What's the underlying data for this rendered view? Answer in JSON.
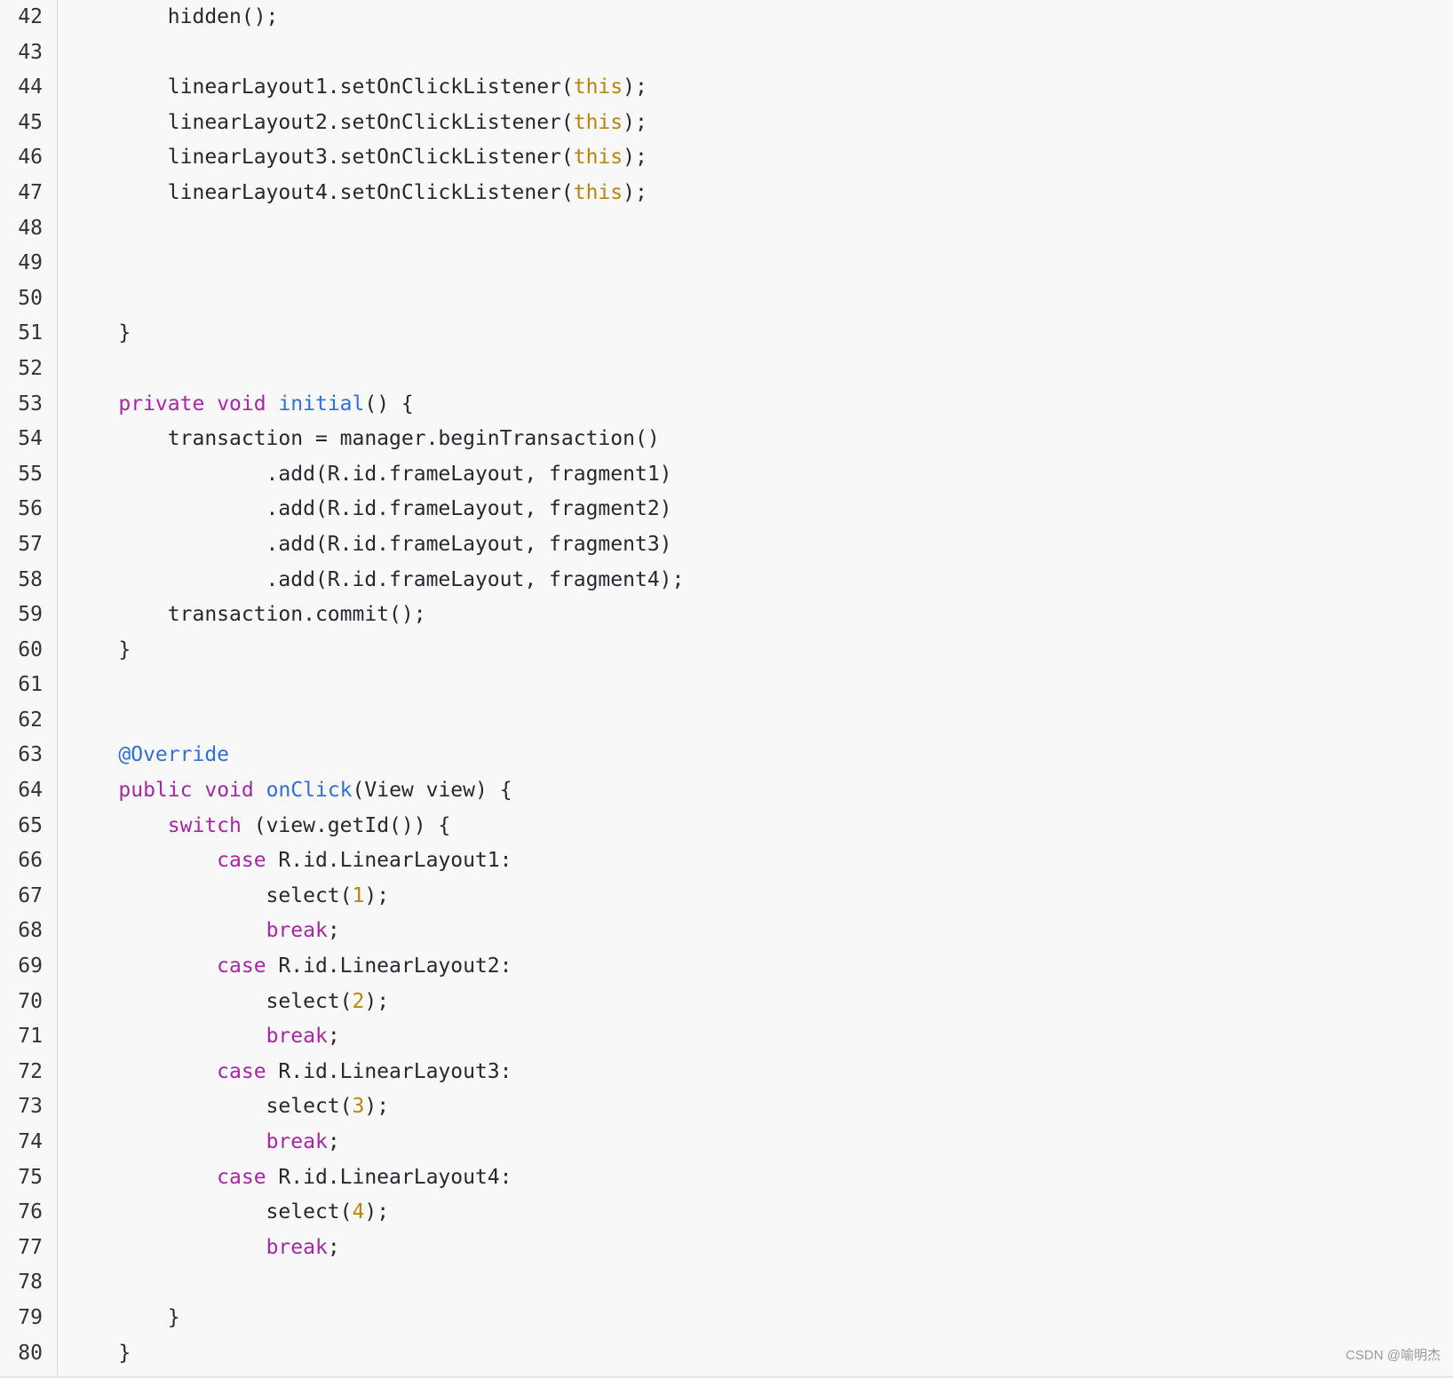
{
  "colors": {
    "background": "#f8f8f8",
    "keyword": "#a626a4",
    "literal": "#b8860b",
    "function": "#2f6fd6",
    "annotation": "#2f6fd6",
    "text": "#24292e"
  },
  "code": {
    "lines": [
      {
        "num": "42",
        "tokens": [
          {
            "t": "txt",
            "v": "        hidden();"
          }
        ]
      },
      {
        "num": "43",
        "tokens": []
      },
      {
        "num": "44",
        "tokens": [
          {
            "t": "txt",
            "v": "        linearLayout1.setOnClickListener("
          },
          {
            "t": "lit",
            "v": "this"
          },
          {
            "t": "txt",
            "v": ");"
          }
        ]
      },
      {
        "num": "45",
        "tokens": [
          {
            "t": "txt",
            "v": "        linearLayout2.setOnClickListener("
          },
          {
            "t": "lit",
            "v": "this"
          },
          {
            "t": "txt",
            "v": ");"
          }
        ]
      },
      {
        "num": "46",
        "tokens": [
          {
            "t": "txt",
            "v": "        linearLayout3.setOnClickListener("
          },
          {
            "t": "lit",
            "v": "this"
          },
          {
            "t": "txt",
            "v": ");"
          }
        ]
      },
      {
        "num": "47",
        "tokens": [
          {
            "t": "txt",
            "v": "        linearLayout4.setOnClickListener("
          },
          {
            "t": "lit",
            "v": "this"
          },
          {
            "t": "txt",
            "v": ");"
          }
        ]
      },
      {
        "num": "48",
        "tokens": []
      },
      {
        "num": "49",
        "tokens": []
      },
      {
        "num": "50",
        "tokens": []
      },
      {
        "num": "51",
        "tokens": [
          {
            "t": "txt",
            "v": "    }"
          }
        ]
      },
      {
        "num": "52",
        "tokens": []
      },
      {
        "num": "53",
        "tokens": [
          {
            "t": "txt",
            "v": "    "
          },
          {
            "t": "kw",
            "v": "private"
          },
          {
            "t": "txt",
            "v": " "
          },
          {
            "t": "kw",
            "v": "void"
          },
          {
            "t": "txt",
            "v": " "
          },
          {
            "t": "fn",
            "v": "initial"
          },
          {
            "t": "txt",
            "v": "() {"
          }
        ]
      },
      {
        "num": "54",
        "tokens": [
          {
            "t": "txt",
            "v": "        transaction = manager.beginTransaction()"
          }
        ]
      },
      {
        "num": "55",
        "tokens": [
          {
            "t": "txt",
            "v": "                .add(R.id.frameLayout, fragment1)"
          }
        ]
      },
      {
        "num": "56",
        "tokens": [
          {
            "t": "txt",
            "v": "                .add(R.id.frameLayout, fragment2)"
          }
        ]
      },
      {
        "num": "57",
        "tokens": [
          {
            "t": "txt",
            "v": "                .add(R.id.frameLayout, fragment3)"
          }
        ]
      },
      {
        "num": "58",
        "tokens": [
          {
            "t": "txt",
            "v": "                .add(R.id.frameLayout, fragment4);"
          }
        ]
      },
      {
        "num": "59",
        "tokens": [
          {
            "t": "txt",
            "v": "        transaction.commit();"
          }
        ]
      },
      {
        "num": "60",
        "tokens": [
          {
            "t": "txt",
            "v": "    }"
          }
        ]
      },
      {
        "num": "61",
        "tokens": []
      },
      {
        "num": "62",
        "tokens": []
      },
      {
        "num": "63",
        "tokens": [
          {
            "t": "txt",
            "v": "    "
          },
          {
            "t": "ann",
            "v": "@Override"
          }
        ]
      },
      {
        "num": "64",
        "tokens": [
          {
            "t": "txt",
            "v": "    "
          },
          {
            "t": "kw",
            "v": "public"
          },
          {
            "t": "txt",
            "v": " "
          },
          {
            "t": "kw",
            "v": "void"
          },
          {
            "t": "txt",
            "v": " "
          },
          {
            "t": "fn",
            "v": "onClick"
          },
          {
            "t": "txt",
            "v": "(View view) {"
          }
        ]
      },
      {
        "num": "65",
        "tokens": [
          {
            "t": "txt",
            "v": "        "
          },
          {
            "t": "kw",
            "v": "switch"
          },
          {
            "t": "txt",
            "v": " (view.getId()) {"
          }
        ]
      },
      {
        "num": "66",
        "tokens": [
          {
            "t": "txt",
            "v": "            "
          },
          {
            "t": "kw",
            "v": "case"
          },
          {
            "t": "txt",
            "v": " R.id.LinearLayout1:"
          }
        ]
      },
      {
        "num": "67",
        "tokens": [
          {
            "t": "txt",
            "v": "                select("
          },
          {
            "t": "lit",
            "v": "1"
          },
          {
            "t": "txt",
            "v": ");"
          }
        ]
      },
      {
        "num": "68",
        "tokens": [
          {
            "t": "txt",
            "v": "                "
          },
          {
            "t": "kw",
            "v": "break"
          },
          {
            "t": "txt",
            "v": ";"
          }
        ]
      },
      {
        "num": "69",
        "tokens": [
          {
            "t": "txt",
            "v": "            "
          },
          {
            "t": "kw",
            "v": "case"
          },
          {
            "t": "txt",
            "v": " R.id.LinearLayout2:"
          }
        ]
      },
      {
        "num": "70",
        "tokens": [
          {
            "t": "txt",
            "v": "                select("
          },
          {
            "t": "lit",
            "v": "2"
          },
          {
            "t": "txt",
            "v": ");"
          }
        ]
      },
      {
        "num": "71",
        "tokens": [
          {
            "t": "txt",
            "v": "                "
          },
          {
            "t": "kw",
            "v": "break"
          },
          {
            "t": "txt",
            "v": ";"
          }
        ]
      },
      {
        "num": "72",
        "tokens": [
          {
            "t": "txt",
            "v": "            "
          },
          {
            "t": "kw",
            "v": "case"
          },
          {
            "t": "txt",
            "v": " R.id.LinearLayout3:"
          }
        ]
      },
      {
        "num": "73",
        "tokens": [
          {
            "t": "txt",
            "v": "                select("
          },
          {
            "t": "lit",
            "v": "3"
          },
          {
            "t": "txt",
            "v": ");"
          }
        ]
      },
      {
        "num": "74",
        "tokens": [
          {
            "t": "txt",
            "v": "                "
          },
          {
            "t": "kw",
            "v": "break"
          },
          {
            "t": "txt",
            "v": ";"
          }
        ]
      },
      {
        "num": "75",
        "tokens": [
          {
            "t": "txt",
            "v": "            "
          },
          {
            "t": "kw",
            "v": "case"
          },
          {
            "t": "txt",
            "v": " R.id.LinearLayout4:"
          }
        ]
      },
      {
        "num": "76",
        "tokens": [
          {
            "t": "txt",
            "v": "                select("
          },
          {
            "t": "lit",
            "v": "4"
          },
          {
            "t": "txt",
            "v": ");"
          }
        ]
      },
      {
        "num": "77",
        "tokens": [
          {
            "t": "txt",
            "v": "                "
          },
          {
            "t": "kw",
            "v": "break"
          },
          {
            "t": "txt",
            "v": ";"
          }
        ]
      },
      {
        "num": "78",
        "tokens": []
      },
      {
        "num": "79",
        "tokens": [
          {
            "t": "txt",
            "v": "        }"
          }
        ]
      },
      {
        "num": "80",
        "tokens": [
          {
            "t": "txt",
            "v": "    }"
          }
        ]
      }
    ]
  },
  "watermark": "CSDN @喻明杰"
}
